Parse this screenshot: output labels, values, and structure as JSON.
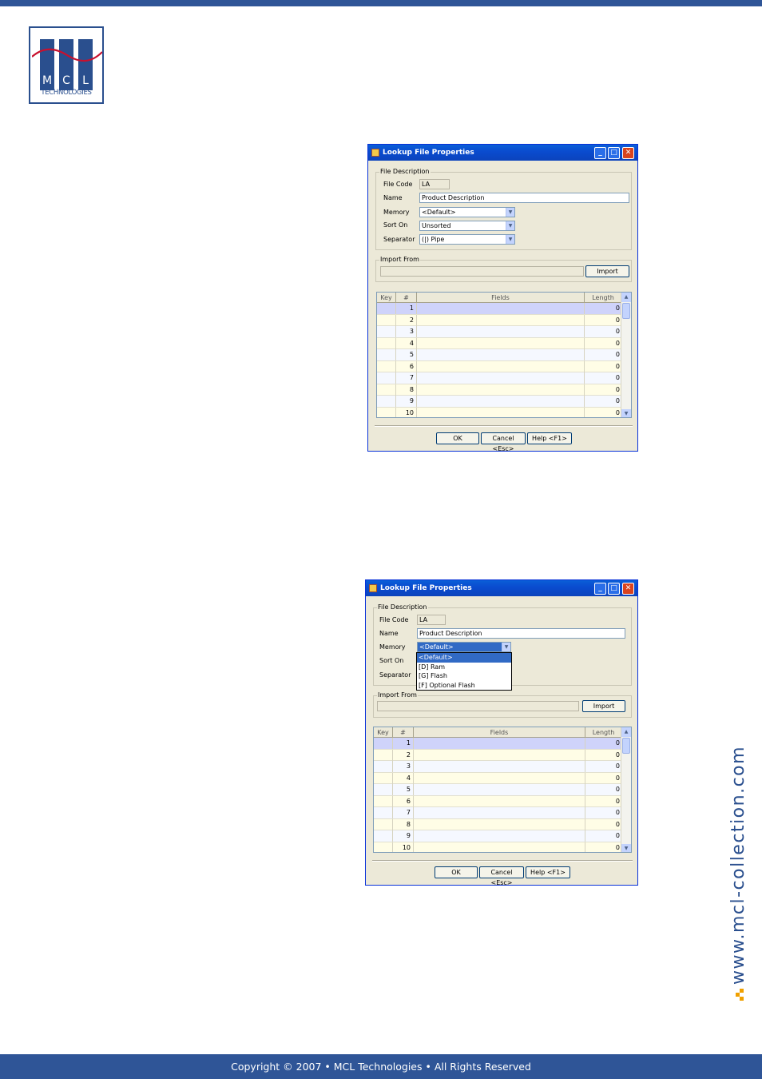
{
  "brand": {
    "logo_letters": [
      "M",
      "C",
      "L"
    ],
    "logo_subtitle": "TECHNOLOGIES",
    "side_url": "www.mcl-collection.com",
    "colors": {
      "brand_blue": "#2f5597",
      "accent_orange": "#f0a000"
    }
  },
  "footer": {
    "text": "Copyright © 2007 • MCL Technologies • All Rights Reserved"
  },
  "dialogs": [
    {
      "title": "Lookup File Properties",
      "file_description_label": "File Description",
      "file_code_label": "File Code",
      "file_code_value": "LA",
      "name_label": "Name",
      "name_value": "Product Description",
      "memory_label": "Memory",
      "memory_value": "<Default>",
      "sort_on_label": "Sort On",
      "sort_on_value": "Unsorted",
      "separator_label": "Separator",
      "separator_value": "(|) Pipe",
      "import_from_label": "Import From",
      "import_button": "Import",
      "grid_headers": {
        "key": "Key",
        "num": "#",
        "fields": "Fields",
        "length": "Length"
      },
      "rows": [
        {
          "num": "1",
          "length": "0"
        },
        {
          "num": "2",
          "length": "0"
        },
        {
          "num": "3",
          "length": "0"
        },
        {
          "num": "4",
          "length": "0"
        },
        {
          "num": "5",
          "length": "0"
        },
        {
          "num": "6",
          "length": "0"
        },
        {
          "num": "7",
          "length": "0"
        },
        {
          "num": "8",
          "length": "0"
        },
        {
          "num": "9",
          "length": "0"
        },
        {
          "num": "10",
          "length": "0"
        }
      ],
      "ok_button": "OK",
      "cancel_button": "Cancel <Esc>",
      "help_button": "Help <F1>"
    },
    {
      "title": "Lookup File Properties",
      "file_description_label": "File Description",
      "file_code_label": "File Code",
      "file_code_value": "LA",
      "name_label": "Name",
      "name_value": "Product Description",
      "memory_label": "Memory",
      "memory_value": "<Default>",
      "memory_options": [
        "<Default>",
        "[D] Ram",
        "[G] Flash",
        "[F] Optional Flash"
      ],
      "sort_on_label": "Sort On",
      "separator_label": "Separator",
      "import_from_label": "Import From",
      "import_button": "Import",
      "grid_headers": {
        "key": "Key",
        "num": "#",
        "fields": "Fields",
        "length": "Length"
      },
      "rows": [
        {
          "num": "1",
          "length": "0"
        },
        {
          "num": "2",
          "length": "0"
        },
        {
          "num": "3",
          "length": "0"
        },
        {
          "num": "4",
          "length": "0"
        },
        {
          "num": "5",
          "length": "0"
        },
        {
          "num": "6",
          "length": "0"
        },
        {
          "num": "7",
          "length": "0"
        },
        {
          "num": "8",
          "length": "0"
        },
        {
          "num": "9",
          "length": "0"
        },
        {
          "num": "10",
          "length": "0"
        }
      ],
      "ok_button": "OK",
      "cancel_button": "Cancel <Esc>",
      "help_button": "Help <F1>"
    }
  ]
}
